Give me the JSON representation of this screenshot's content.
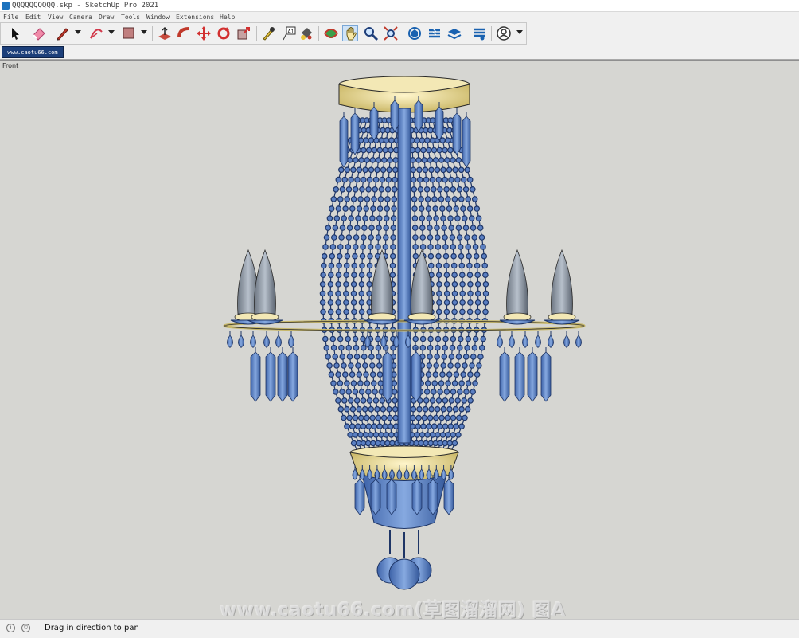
{
  "window": {
    "title": "QQQQQQQQQQ.skp - SketchUp Pro 2021"
  },
  "menu": [
    "File",
    "Edit",
    "View",
    "Camera",
    "Draw",
    "Tools",
    "Window",
    "Extensions",
    "Help"
  ],
  "toolbar": {
    "tools": [
      "select",
      "eraser",
      "line",
      "arc",
      "rectangle",
      "push-pull",
      "follow-me",
      "move",
      "rotate",
      "scale",
      "tape-measure",
      "text",
      "paint-bucket",
      "orbit",
      "pan",
      "zoom",
      "zoom-extents",
      "warehouse",
      "extension-warehouse",
      "layout",
      "style-builder",
      "account"
    ],
    "active_tool": "pan"
  },
  "scene_tab": {
    "label": "www.caotu66.com"
  },
  "viewport": {
    "view_label": "Front",
    "background": "#d6d6d2",
    "model": "crystal chandelier"
  },
  "watermark": {
    "text": "www.caotu66.com(草图溜溜网) 图A"
  },
  "status": {
    "message": "Drag in direction to pan"
  },
  "colors": {
    "crystal": "#5f86c8",
    "crystal_dark": "#2b4f8f",
    "gold": "#efe2a2",
    "candle": "#8e9aa8",
    "tab": "#1c3f7a"
  }
}
